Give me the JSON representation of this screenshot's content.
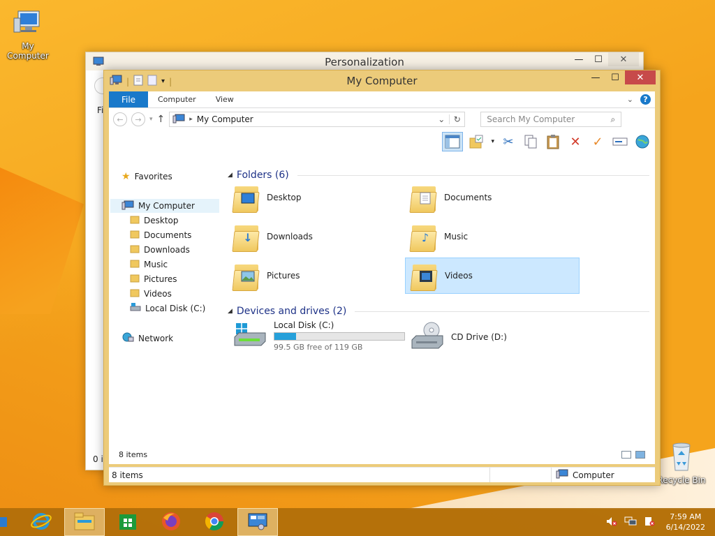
{
  "desktop": {
    "my_computer_label": "My Computer",
    "recycle_bin_label": "Recycle Bin"
  },
  "back_window": {
    "title": "Personalization",
    "fragment_top": "Fi",
    "fragment_bottom": "0 it"
  },
  "window": {
    "title": "My Computer",
    "caption": {
      "minimize": "—",
      "maximize": "☐",
      "close": "✕"
    },
    "ribbon": {
      "file_tab": "File",
      "tabs": [
        "Computer",
        "View"
      ]
    },
    "address": {
      "path": "My Computer",
      "search_placeholder": "Search My Computer"
    },
    "nav": {
      "favorites": "Favorites",
      "my_computer": "My Computer",
      "children": [
        "Desktop",
        "Documents",
        "Downloads",
        "Music",
        "Pictures",
        "Videos",
        "Local Disk (C:)"
      ],
      "network": "Network"
    },
    "groups": {
      "folders_header": "Folders (6)",
      "devices_header": "Devices and drives (2)"
    },
    "folders": [
      "Desktop",
      "Documents",
      "Downloads",
      "Music",
      "Pictures",
      "Videos"
    ],
    "drives": {
      "local": {
        "name": "Local Disk (C:)",
        "free_text": "99.5 GB free of 119 GB",
        "used_fraction": 0.164
      },
      "cd": {
        "name": "CD Drive (D:)"
      }
    },
    "inner_status": "8 items",
    "status_left": "8 items",
    "status_right": "Computer"
  },
  "taskbar": {
    "time": "7:59 AM",
    "date": "6/14/2022"
  },
  "colors": {
    "accent": "#1979ca",
    "selection": "#cce8ff",
    "progress": "#26a0da",
    "close": "#c74a4a"
  }
}
